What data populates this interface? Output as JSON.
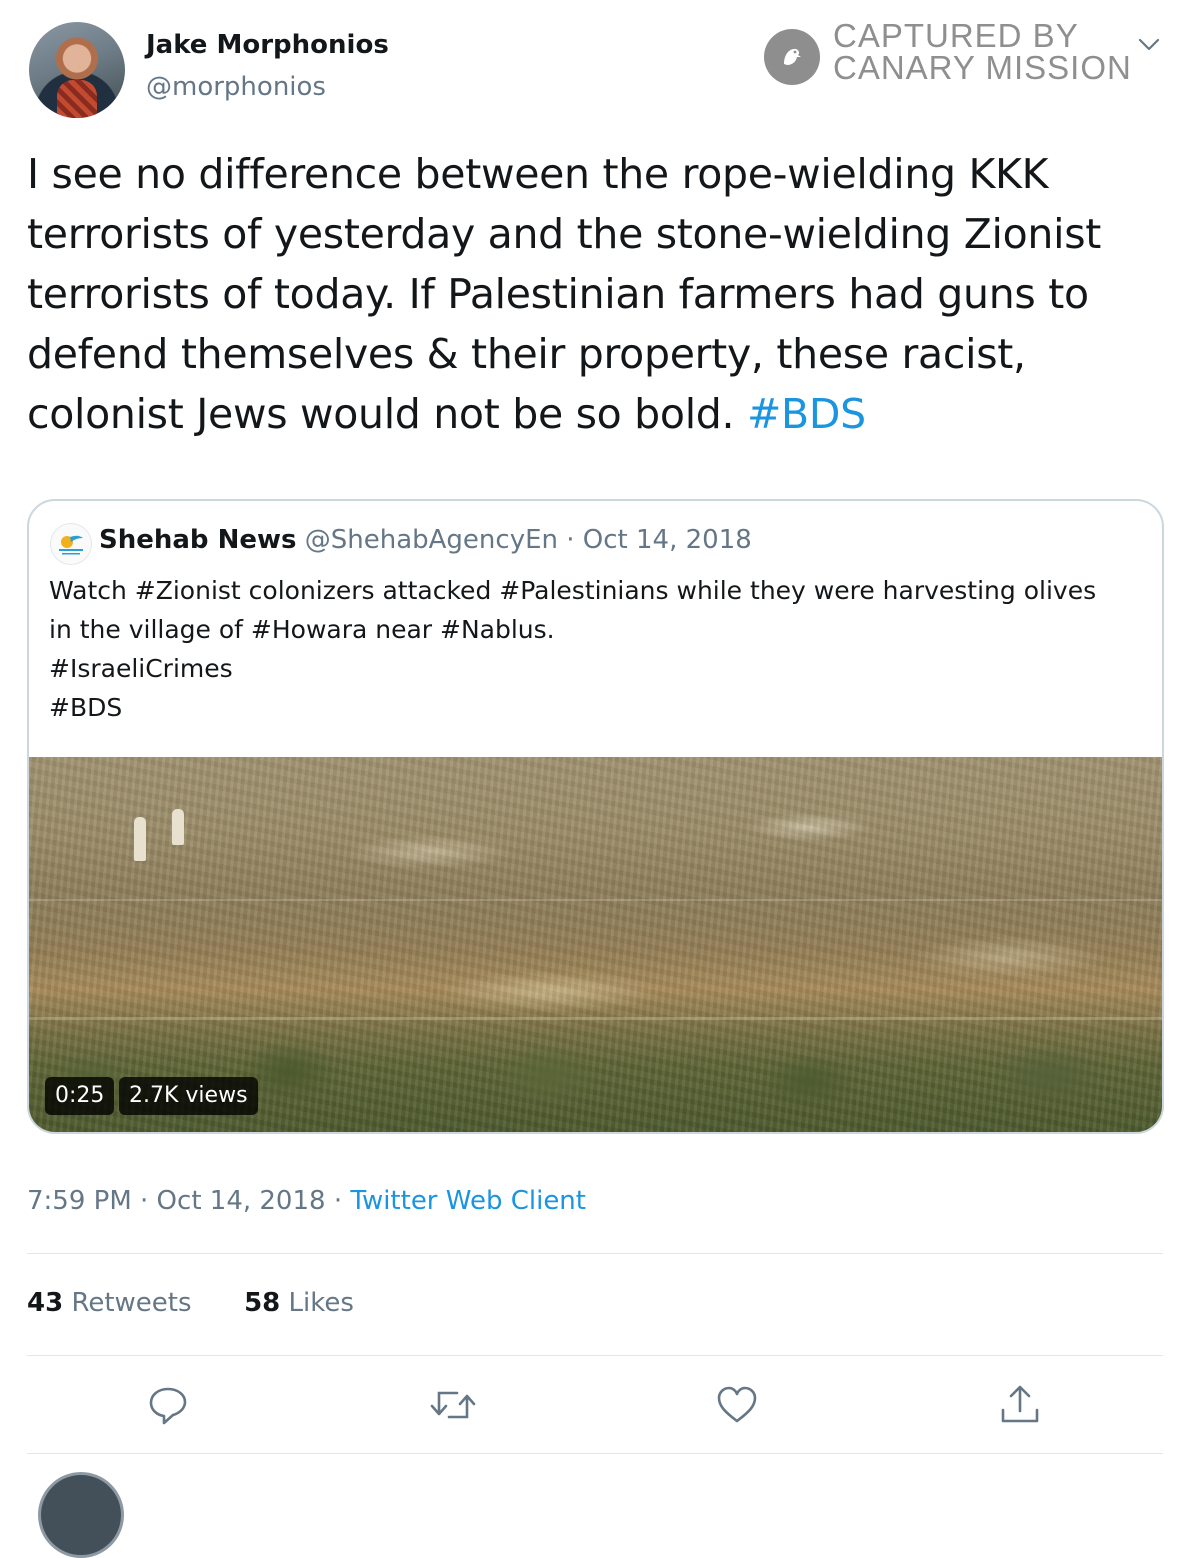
{
  "author": {
    "name": "Jake Morphonios",
    "handle": "@morphonios"
  },
  "watermark": {
    "line1": "CAPTURED BY",
    "line2": "CANARY MISSION"
  },
  "tweet": {
    "text_before": "I see no difference between the rope-wielding KKK\nterrorists of yesterday and the stone-wielding Zionist\nterrorists of today.  If Palestinian farmers had guns to\ndefend themselves & their property, these racist,\ncolonist Jews would not be so bold. ",
    "hashtag": "#BDS"
  },
  "quoted": {
    "name": "Shehab News",
    "meta": "@ShehabAgencyEn · Oct 14, 2018",
    "text": "Watch #Zionist colonizers attacked #Palestinians while they were harvesting olives\nin the village of #Howara near #Nablus.\n#IsraeliCrimes\n#BDS",
    "video_duration": "0:25",
    "video_views": "2.7K views"
  },
  "footer": {
    "time": "7:59 PM · Oct 14, 2018 · ",
    "source": "Twitter Web Client",
    "retweets_count": "43",
    "retweets_label": " Retweets",
    "likes_count": "58",
    "likes_label": " Likes"
  },
  "icons": [
    "chevron-down-icon",
    "reply-icon",
    "retweet-icon",
    "like-icon",
    "share-icon",
    "canary-mission-logo-icon"
  ],
  "colors": {
    "link": "#1b95e0",
    "secondary_text": "#657786",
    "border": "#ccd6dd"
  }
}
